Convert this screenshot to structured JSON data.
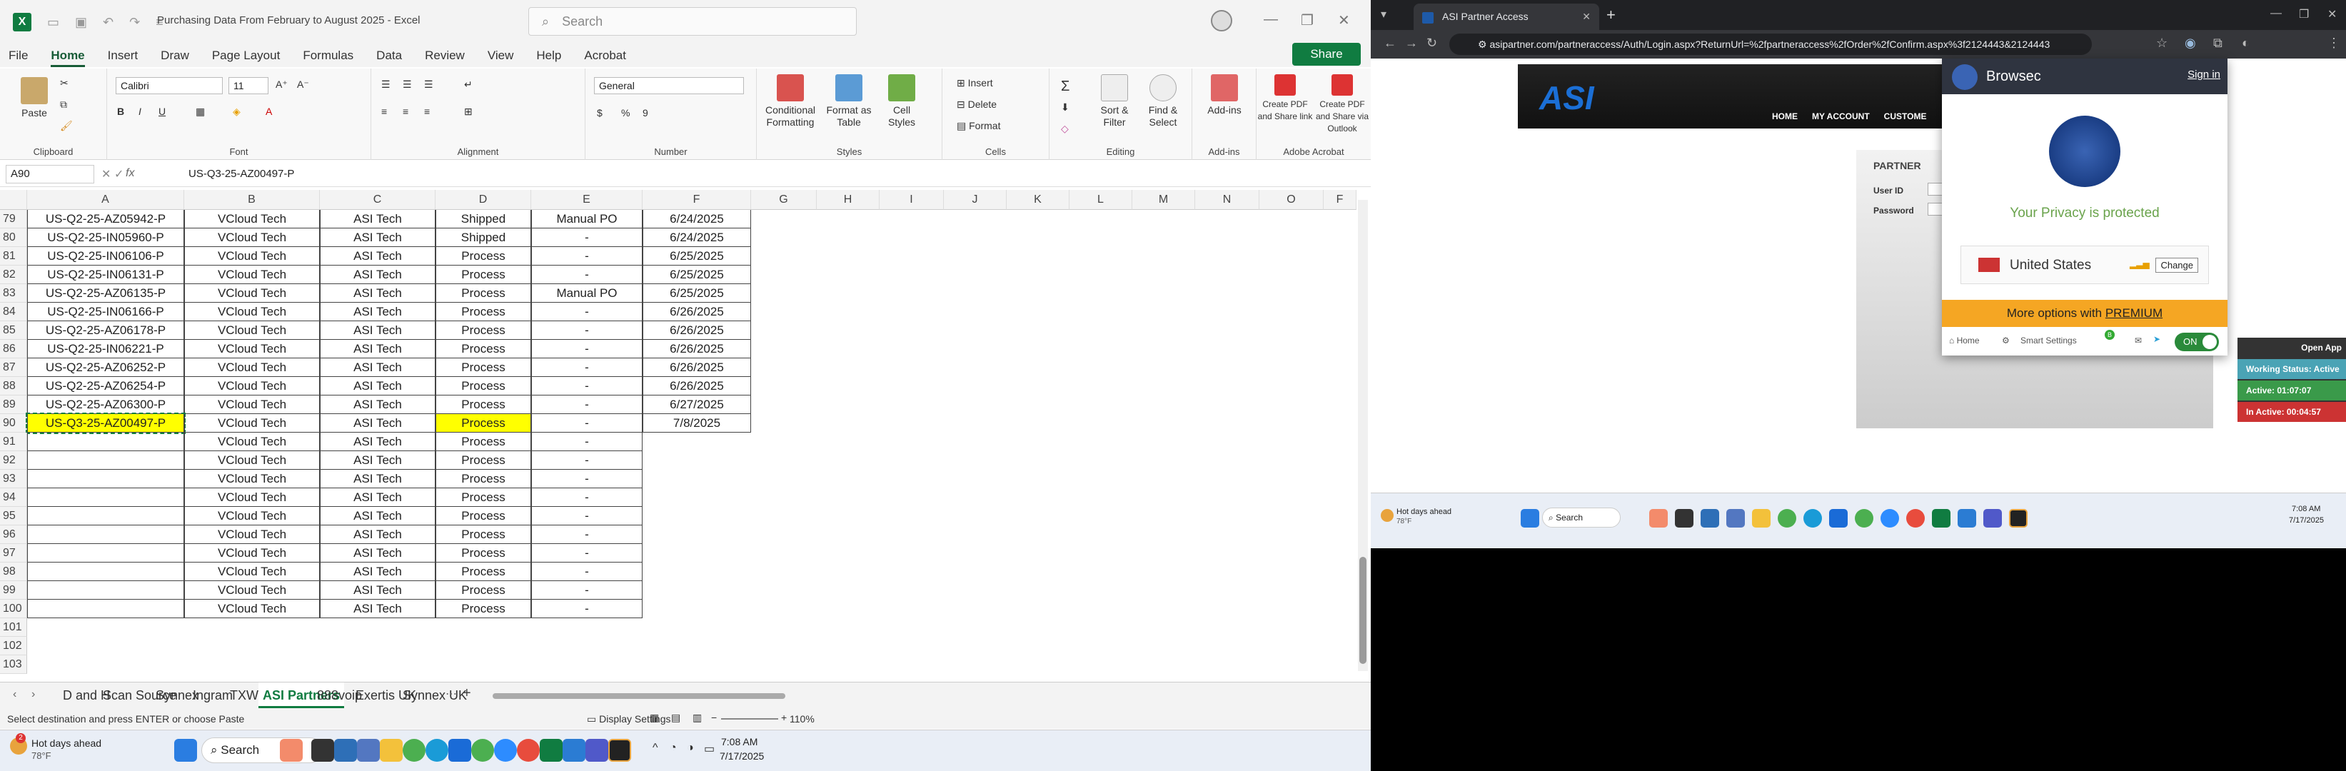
{
  "excel": {
    "window_title": "Purchasing Data From February to August 2025  -  Excel",
    "search_placeholder": "Search",
    "share_label": "Share",
    "menu_tabs": [
      "File",
      "Home",
      "Insert",
      "Draw",
      "Page Layout",
      "Formulas",
      "Data",
      "Review",
      "View",
      "Help",
      "Acrobat"
    ],
    "ribbon": {
      "paste": "Paste",
      "font_name": "Calibri",
      "font_size": "11",
      "number_format": "General",
      "conditional": "Conditional Formatting",
      "format_table": "Format as Table",
      "cell_styles": "Cell Styles",
      "insert": "Insert",
      "delete": "Delete",
      "format": "Format",
      "sort_filter": "Sort & Filter",
      "find_select": "Find & Select",
      "addins": "Add-ins",
      "pdf_share": "Create PDF and Share link",
      "pdf_outlook": "Create PDF and Share via Outlook",
      "groups": [
        "Clipboard",
        "Font",
        "Alignment",
        "Number",
        "Styles",
        "Cells",
        "Editing",
        "Add-ins",
        "Adobe Acrobat"
      ]
    },
    "name_box": "A90",
    "fx": "fx",
    "formula_value": "US-Q3-25-AZ00497-P",
    "columns": [
      "A",
      "B",
      "C",
      "D",
      "E",
      "F",
      "G",
      "H",
      "I",
      "J",
      "K",
      "L",
      "M",
      "N",
      "O",
      "F"
    ],
    "rows": [
      {
        "num": "79",
        "a": "US-Q2-25-AZ05942-P",
        "b": "VCloud Tech",
        "c": "ASI Tech",
        "d": "Shipped",
        "e": "Manual PO",
        "f": "6/24/2025"
      },
      {
        "num": "80",
        "a": "US-Q2-25-IN05960-P",
        "b": "VCloud Tech",
        "c": "ASI Tech",
        "d": "Shipped",
        "e": "-",
        "f": "6/24/2025"
      },
      {
        "num": "81",
        "a": "US-Q2-25-IN06106-P",
        "b": "VCloud Tech",
        "c": "ASI Tech",
        "d": "Process",
        "e": "-",
        "f": "6/25/2025"
      },
      {
        "num": "82",
        "a": "US-Q2-25-IN06131-P",
        "b": "VCloud Tech",
        "c": "ASI Tech",
        "d": "Process",
        "e": "-",
        "f": "6/25/2025"
      },
      {
        "num": "83",
        "a": "US-Q2-25-AZ06135-P",
        "b": "VCloud Tech",
        "c": "ASI Tech",
        "d": "Process",
        "e": "Manual PO",
        "f": "6/25/2025"
      },
      {
        "num": "84",
        "a": "US-Q2-25-IN06166-P",
        "b": "VCloud Tech",
        "c": "ASI Tech",
        "d": "Process",
        "e": "-",
        "f": "6/26/2025"
      },
      {
        "num": "85",
        "a": "US-Q2-25-AZ06178-P",
        "b": "VCloud Tech",
        "c": "ASI Tech",
        "d": "Process",
        "e": "-",
        "f": "6/26/2025"
      },
      {
        "num": "86",
        "a": "US-Q2-25-IN06221-P",
        "b": "VCloud Tech",
        "c": "ASI Tech",
        "d": "Process",
        "e": "-",
        "f": "6/26/2025"
      },
      {
        "num": "87",
        "a": "US-Q2-25-AZ06252-P",
        "b": "VCloud Tech",
        "c": "ASI Tech",
        "d": "Process",
        "e": "-",
        "f": "6/26/2025"
      },
      {
        "num": "88",
        "a": "US-Q2-25-AZ06254-P",
        "b": "VCloud Tech",
        "c": "ASI Tech",
        "d": "Process",
        "e": "-",
        "f": "6/26/2025"
      },
      {
        "num": "89",
        "a": "US-Q2-25-AZ06300-P",
        "b": "VCloud Tech",
        "c": "ASI Tech",
        "d": "Process",
        "e": "-",
        "f": "6/27/2025"
      },
      {
        "num": "90",
        "a": "US-Q3-25-AZ00497-P",
        "b": "VCloud Tech",
        "c": "ASI Tech",
        "d": "Process",
        "e": "-",
        "f": "7/8/2025"
      },
      {
        "num": "91",
        "a": "",
        "b": "VCloud Tech",
        "c": "ASI Tech",
        "d": "Process",
        "e": "-",
        "f": ""
      },
      {
        "num": "92",
        "a": "",
        "b": "VCloud Tech",
        "c": "ASI Tech",
        "d": "Process",
        "e": "-",
        "f": ""
      },
      {
        "num": "93",
        "a": "",
        "b": "VCloud Tech",
        "c": "ASI Tech",
        "d": "Process",
        "e": "-",
        "f": ""
      },
      {
        "num": "94",
        "a": "",
        "b": "VCloud Tech",
        "c": "ASI Tech",
        "d": "Process",
        "e": "-",
        "f": ""
      },
      {
        "num": "95",
        "a": "",
        "b": "VCloud Tech",
        "c": "ASI Tech",
        "d": "Process",
        "e": "-",
        "f": ""
      },
      {
        "num": "96",
        "a": "",
        "b": "VCloud Tech",
        "c": "ASI Tech",
        "d": "Process",
        "e": "-",
        "f": ""
      },
      {
        "num": "97",
        "a": "",
        "b": "VCloud Tech",
        "c": "ASI Tech",
        "d": "Process",
        "e": "-",
        "f": ""
      },
      {
        "num": "98",
        "a": "",
        "b": "VCloud Tech",
        "c": "ASI Tech",
        "d": "Process",
        "e": "-",
        "f": ""
      },
      {
        "num": "99",
        "a": "",
        "b": "VCloud Tech",
        "c": "ASI Tech",
        "d": "Process",
        "e": "-",
        "f": ""
      },
      {
        "num": "100",
        "a": "",
        "b": "VCloud Tech",
        "c": "ASI Tech",
        "d": "Process",
        "e": "-",
        "f": ""
      },
      {
        "num": "101",
        "a": "",
        "b": "",
        "c": "",
        "d": "",
        "e": "",
        "f": ""
      },
      {
        "num": "102",
        "a": "",
        "b": "",
        "c": "",
        "d": "",
        "e": "",
        "f": ""
      },
      {
        "num": "103",
        "a": "",
        "b": "",
        "c": "",
        "d": "",
        "e": "",
        "f": ""
      }
    ],
    "sheet_tabs": [
      "D and H",
      "Scan Source",
      "Synnex",
      "Ingram",
      "TXWH",
      "ASI Partners",
      "888voip",
      "Exertis UK",
      "Synnex UK"
    ],
    "active_sheet": "ASI Partners",
    "status_text": "Select destination and press ENTER or choose Paste",
    "display_settings": "Display Settings",
    "zoom": "110%",
    "accent": "#107c41"
  },
  "taskbar": {
    "weather_title": "Hot days ahead",
    "weather_temp": "78°F",
    "weather_badge": "2",
    "search": "Search",
    "time": "7:08 AM",
    "date": "7/17/2025"
  },
  "browser": {
    "tab_title": "ASI Partner Access",
    "url": "asipartner.com/partneraccess/Auth/Login.aspx?ReturnUrl=%2fpartneraccess%2fOrder%2fConfirm.aspx%3f2124443&2124443",
    "asi_logo": "ASI",
    "asi_nav": [
      "HOME",
      "MY ACCOUNT",
      "CUSTOME"
    ],
    "panel_title": "PARTNER",
    "user_id_label": "User ID",
    "password_label": "Password",
    "browsec": {
      "title": "Browsec",
      "sign_in": "Sign in",
      "protected": "Your Privacy is protected",
      "country": "United States",
      "change": "Change",
      "premium_text": "More options with ",
      "premium_link": "PREMIUM",
      "home": "Home",
      "smart": "Smart Settings",
      "smart_badge": "B",
      "toggle": "ON"
    },
    "side_widget": {
      "open_app": "Open App",
      "working": "Working Status: Active",
      "active": "Active: 01:07:07",
      "inactive": "In Active: 00:04:57"
    },
    "taskbar": {
      "weather_title": "Hot days ahead",
      "weather_temp": "78°F",
      "search": "Search",
      "time": "7:08 AM",
      "date": "7/17/2025"
    }
  }
}
